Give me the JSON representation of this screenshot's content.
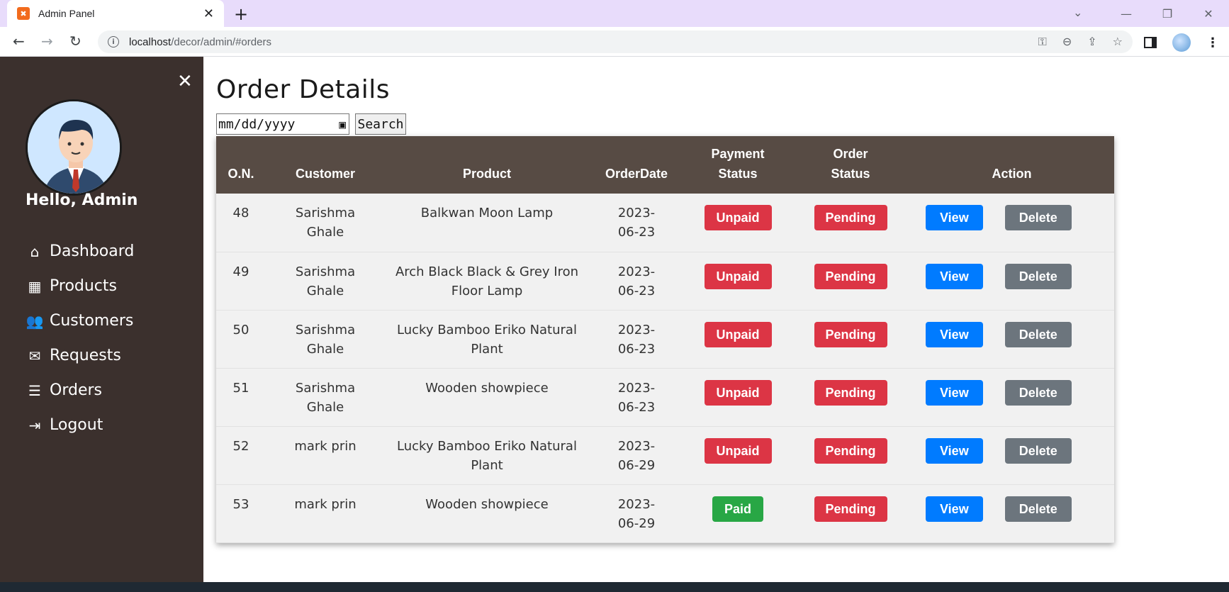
{
  "browser": {
    "tab_title": "Admin Panel",
    "url_host": "localhost",
    "url_path": "/decor/admin/#orders"
  },
  "sidebar": {
    "greeting": "Hello, Admin",
    "items": [
      {
        "label": "Dashboard",
        "icon": "home-icon"
      },
      {
        "label": "Products",
        "icon": "grid-icon"
      },
      {
        "label": "Customers",
        "icon": "users-icon"
      },
      {
        "label": "Requests",
        "icon": "envelope-icon"
      },
      {
        "label": "Orders",
        "icon": "list-icon"
      },
      {
        "label": "Logout",
        "icon": "sign-out-icon"
      }
    ]
  },
  "main": {
    "title": "Order Details",
    "date_placeholder": "mm/dd/yyyy",
    "search_label": "Search",
    "columns": [
      "O.N.",
      "Customer",
      "Product",
      "OrderDate",
      "Payment Status",
      "Order Status",
      "Action"
    ],
    "rows": [
      {
        "on": "48",
        "customer": "Sarishma Ghale",
        "product": "Balkwan Moon Lamp",
        "date": "2023-06-23",
        "payment": "Unpaid",
        "status": "Pending",
        "view": "View",
        "delete": "Delete"
      },
      {
        "on": "49",
        "customer": "Sarishma Ghale",
        "product": "Arch Black Black & Grey Iron Floor Lamp",
        "date": "2023-06-23",
        "payment": "Unpaid",
        "status": "Pending",
        "view": "View",
        "delete": "Delete"
      },
      {
        "on": "50",
        "customer": "Sarishma Ghale",
        "product": "Lucky Bamboo Eriko Natural Plant",
        "date": "2023-06-23",
        "payment": "Unpaid",
        "status": "Pending",
        "view": "View",
        "delete": "Delete"
      },
      {
        "on": "51",
        "customer": "Sarishma Ghale",
        "product": "Wooden showpiece",
        "date": "2023-06-23",
        "payment": "Unpaid",
        "status": "Pending",
        "view": "View",
        "delete": "Delete"
      },
      {
        "on": "52",
        "customer": "mark prin",
        "product": "Lucky Bamboo Eriko Natural Plant",
        "date": "2023-06-29",
        "payment": "Unpaid",
        "status": "Pending",
        "view": "View",
        "delete": "Delete"
      },
      {
        "on": "53",
        "customer": "mark prin",
        "product": "Wooden showpiece",
        "date": "2023-06-29",
        "payment": "Paid",
        "status": "Pending",
        "view": "View",
        "delete": "Delete"
      }
    ]
  },
  "colors": {
    "sidebar_bg": "#3b302d",
    "table_header_bg": "#574b44",
    "danger": "#dc3545",
    "success": "#28a745",
    "primary": "#007bff",
    "secondary": "#6c757d"
  }
}
